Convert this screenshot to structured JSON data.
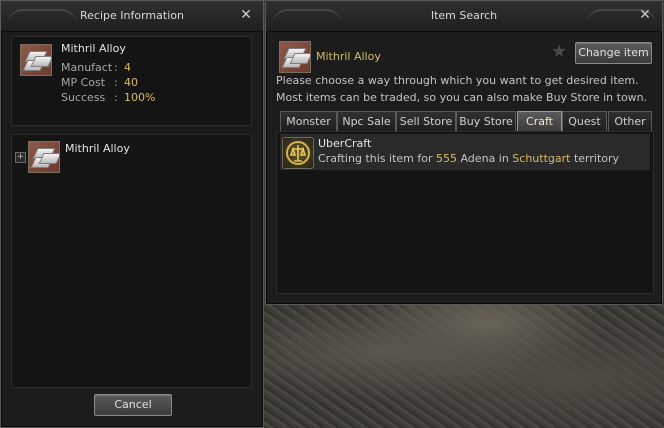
{
  "recipe_window": {
    "title": "Recipe Information",
    "item_name": "Mithril Alloy",
    "stats": [
      {
        "label": "Manufact",
        "sep": ":",
        "value": "4"
      },
      {
        "label": "MP Cost",
        "sep": ":",
        "value": "40"
      },
      {
        "label": "Success",
        "sep": ":",
        "value": "100%"
      }
    ],
    "tree_item_name": "Mithril Alloy",
    "cancel_label": "Cancel",
    "close_glyph": "✕"
  },
  "search_window": {
    "title": "Item Search",
    "item_name": "Mithril Alloy",
    "change_item_label": "Change item",
    "instructions": [
      "Please choose a way through which you want to get desired item.",
      "Most items can be traded, so you can also make Buy Store in town."
    ],
    "tabs": [
      "Monster",
      "Npc Sale",
      "Sell Store",
      "Buy Store",
      "Craft",
      "Quest",
      "Other"
    ],
    "active_tab": "Craft",
    "result": {
      "name": "UberCraft",
      "desc_prefix": "Crafting this item for ",
      "price": "555",
      "desc_mid": " Adena in ",
      "town": "Schuttgart",
      "desc_suffix": " territory"
    },
    "close_glyph": "✕"
  },
  "icons": {
    "item": "mithril-alloy-icon",
    "expand": "plus-icon",
    "favorite": "star-icon",
    "craft": "craft-emblem-icon",
    "close": "close-icon"
  },
  "colors": {
    "highlight_text": "#d8b96a",
    "window_bg": "#1c1c1c",
    "panel_bg": "#141414"
  }
}
